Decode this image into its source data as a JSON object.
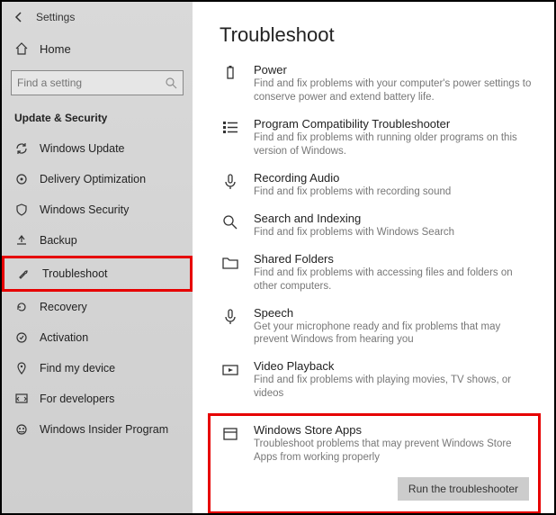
{
  "titlebar": {
    "title": "Settings"
  },
  "home": {
    "label": "Home"
  },
  "search": {
    "placeholder": "Find a setting"
  },
  "section": {
    "header": "Update & Security"
  },
  "nav": {
    "items": [
      {
        "label": "Windows Update"
      },
      {
        "label": "Delivery Optimization"
      },
      {
        "label": "Windows Security"
      },
      {
        "label": "Backup"
      },
      {
        "label": "Troubleshoot"
      },
      {
        "label": "Recovery"
      },
      {
        "label": "Activation"
      },
      {
        "label": "Find my device"
      },
      {
        "label": "For developers"
      },
      {
        "label": "Windows Insider Program"
      }
    ]
  },
  "main": {
    "title": "Troubleshoot",
    "items": [
      {
        "title": "Power",
        "desc": "Find and fix problems with your computer's power settings to conserve power and extend battery life."
      },
      {
        "title": "Program Compatibility Troubleshooter",
        "desc": "Find and fix problems with running older programs on this version of Windows."
      },
      {
        "title": "Recording Audio",
        "desc": "Find and fix problems with recording sound"
      },
      {
        "title": "Search and Indexing",
        "desc": "Find and fix problems with Windows Search"
      },
      {
        "title": "Shared Folders",
        "desc": "Find and fix problems with accessing files and folders on other computers."
      },
      {
        "title": "Speech",
        "desc": "Get your microphone ready and fix problems that may prevent Windows from hearing you"
      },
      {
        "title": "Video Playback",
        "desc": "Find and fix problems with playing movies, TV shows, or videos"
      },
      {
        "title": "Windows Store Apps",
        "desc": "Troubleshoot problems that may prevent Windows Store Apps from working properly"
      }
    ],
    "run_button": "Run the troubleshooter"
  }
}
